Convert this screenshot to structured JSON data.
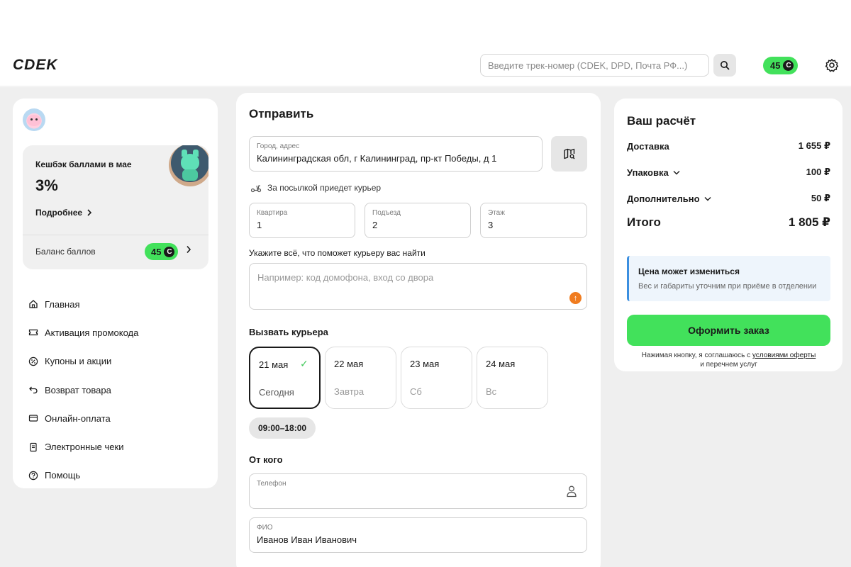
{
  "header": {
    "logo": "CDEK",
    "search_placeholder": "Введите трек-номер (CDEK, DPD, Почта РФ...)",
    "points": "45",
    "coin_symbol": "C"
  },
  "sidebar": {
    "cashback_title": "Кешбэк баллами в мае",
    "cashback_percent": "3%",
    "details_label": "Подробнее",
    "balance_label": "Баланс баллов",
    "balance_points": "45",
    "menu": [
      {
        "label": "Главная",
        "icon": "home-icon"
      },
      {
        "label": "Активация промокода",
        "icon": "ticket-icon"
      },
      {
        "label": "Купоны и акции",
        "icon": "percent-icon"
      },
      {
        "label": "Возврат товара",
        "icon": "return-icon"
      },
      {
        "label": "Онлайн-оплата",
        "icon": "card-icon"
      },
      {
        "label": "Электронные чеки",
        "icon": "receipt-icon"
      },
      {
        "label": "Помощь",
        "icon": "help-icon"
      }
    ]
  },
  "form": {
    "title": "Отправить",
    "address_label": "Город, адрес",
    "address_value": "Калининградская обл, г Калининград, пр-кт Победы, д 1",
    "courier_note": "За посылкой приедет курьер",
    "apartment_label": "Квартира",
    "apartment_value": "1",
    "entrance_label": "Подъезд",
    "entrance_value": "2",
    "floor_label": "Этаж",
    "floor_value": "3",
    "hint_label": "Укажите всё, что поможет курьеру вас найти",
    "hint_placeholder": "Например: код домофона, вход со двора",
    "call_courier_title": "Вызвать курьера",
    "dates": [
      {
        "date": "21 мая",
        "day": "Сегодня",
        "selected": true
      },
      {
        "date": "22 мая",
        "day": "Завтра",
        "selected": false
      },
      {
        "date": "23 мая",
        "day": "Сб",
        "selected": false
      },
      {
        "date": "24 мая",
        "day": "Вс",
        "selected": false
      }
    ],
    "time_slot": "09:00–18:00",
    "from_title": "От кого",
    "phone_label": "Телефон",
    "phone_value": "",
    "name_label": "ФИО",
    "name_value": "Иванов Иван Иванович"
  },
  "summary": {
    "title": "Ваш расчёт",
    "delivery_label": "Доставка",
    "delivery_value": "1 655 ₽",
    "packaging_label": "Упаковка",
    "packaging_value": "100 ₽",
    "extra_label": "Дополнительно",
    "extra_value": "50 ₽",
    "total_label": "Итого",
    "total_value": "1 805 ₽",
    "notice_title": "Цена может измениться",
    "notice_text": "Вес и габариты уточним при приёме в отделении",
    "order_button": "Оформить заказ",
    "agree_prefix": "Нажимая кнопку, я соглашаюсь с",
    "agree_link": "условиями оферты",
    "agree_suffix": "и перечнем услуг"
  },
  "colors": {
    "accent_green": "#42e15b",
    "notice_blue": "#3b8fe0",
    "upload_orange": "#f07c1f"
  }
}
